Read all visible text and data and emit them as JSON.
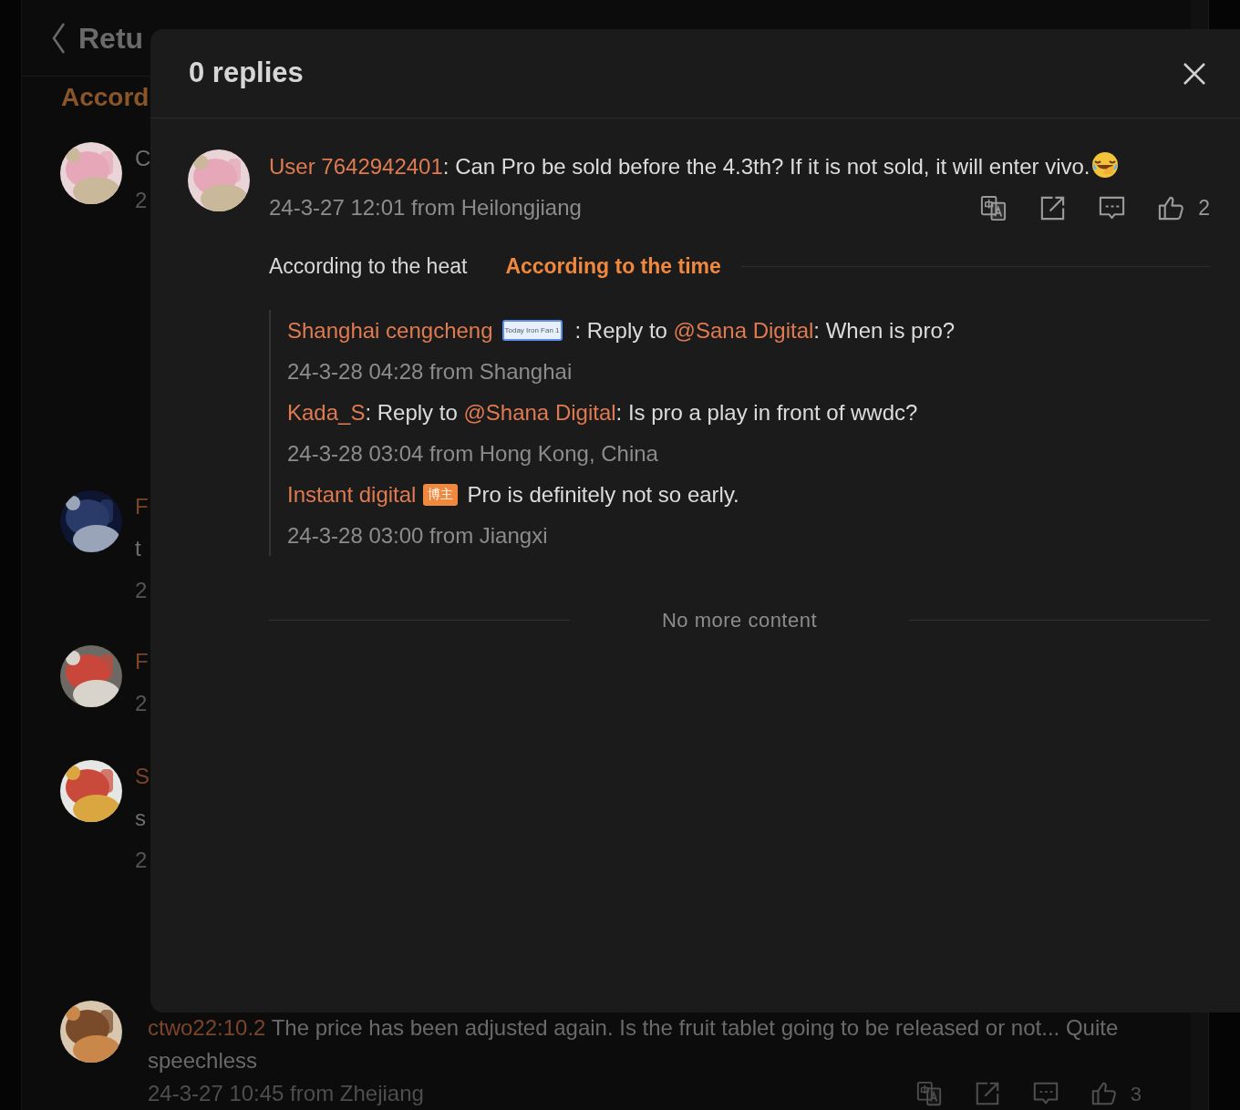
{
  "background": {
    "back_label": "Retu",
    "sort_label": "Accord",
    "comments": [
      {
        "fragments": [
          {
            "kind": "text",
            "text": "C"
          },
          {
            "kind": "meta",
            "text": "2"
          }
        ]
      },
      {
        "fragments": [
          {
            "kind": "name",
            "text": "F"
          },
          {
            "kind": "text",
            "text": "t"
          },
          {
            "kind": "meta",
            "text": "2"
          }
        ]
      },
      {
        "fragments": [
          {
            "kind": "name",
            "text": "F"
          },
          {
            "kind": "meta",
            "text": "2"
          }
        ]
      },
      {
        "fragments": [
          {
            "kind": "name",
            "text": "S"
          },
          {
            "kind": "text",
            "text": "s"
          },
          {
            "kind": "meta",
            "text": "2"
          }
        ]
      }
    ],
    "last_comment": {
      "user": "ctwo22:10.2",
      "text": " The price has been adjusted again. Is the fruit tablet going to be released or not... Quite speechless",
      "meta": "24-3-27 10:45 from Zhejiang",
      "likes": "3"
    }
  },
  "modal": {
    "title": "0 replies",
    "comment": {
      "user": "User 7642942401",
      "text": ": Can Pro be sold before the 4.3th? If it is not sold, it will enter vivo.",
      "meta": "24-3-27 12:01 from Heilongjiang",
      "likes": "2"
    },
    "sort_tabs": [
      {
        "label": "According to the heat",
        "selected": false
      },
      {
        "label": "According to the time",
        "selected": true
      }
    ],
    "replies": [
      {
        "user": "Shanghai cengcheng",
        "badge": {
          "kind": "fan",
          "text": "Today Iron Fan 1"
        },
        "parts": [
          {
            "kind": "plain",
            "text": " : Reply to "
          },
          {
            "kind": "mention",
            "text": "@Sana Digital"
          },
          {
            "kind": "plain",
            "text": ": When is pro?"
          }
        ],
        "meta": "24-3-28 04:28 from Shanghai"
      },
      {
        "user": "Kada_S",
        "parts": [
          {
            "kind": "plain",
            "text": ": Reply to "
          },
          {
            "kind": "mention",
            "text": "@Shana Digital"
          },
          {
            "kind": "plain",
            "text": ": Is pro a play in front of wwdc?"
          }
        ],
        "meta": "24-3-28 03:04 from Hong Kong, China"
      },
      {
        "user": "Instant digital",
        "badge": {
          "kind": "author",
          "text": "博主"
        },
        "parts": [
          {
            "kind": "plain",
            "text": "Pro is definitely not so early."
          }
        ],
        "meta": "24-3-28 03:00 from Jiangxi"
      }
    ],
    "end_text": "No more content"
  }
}
